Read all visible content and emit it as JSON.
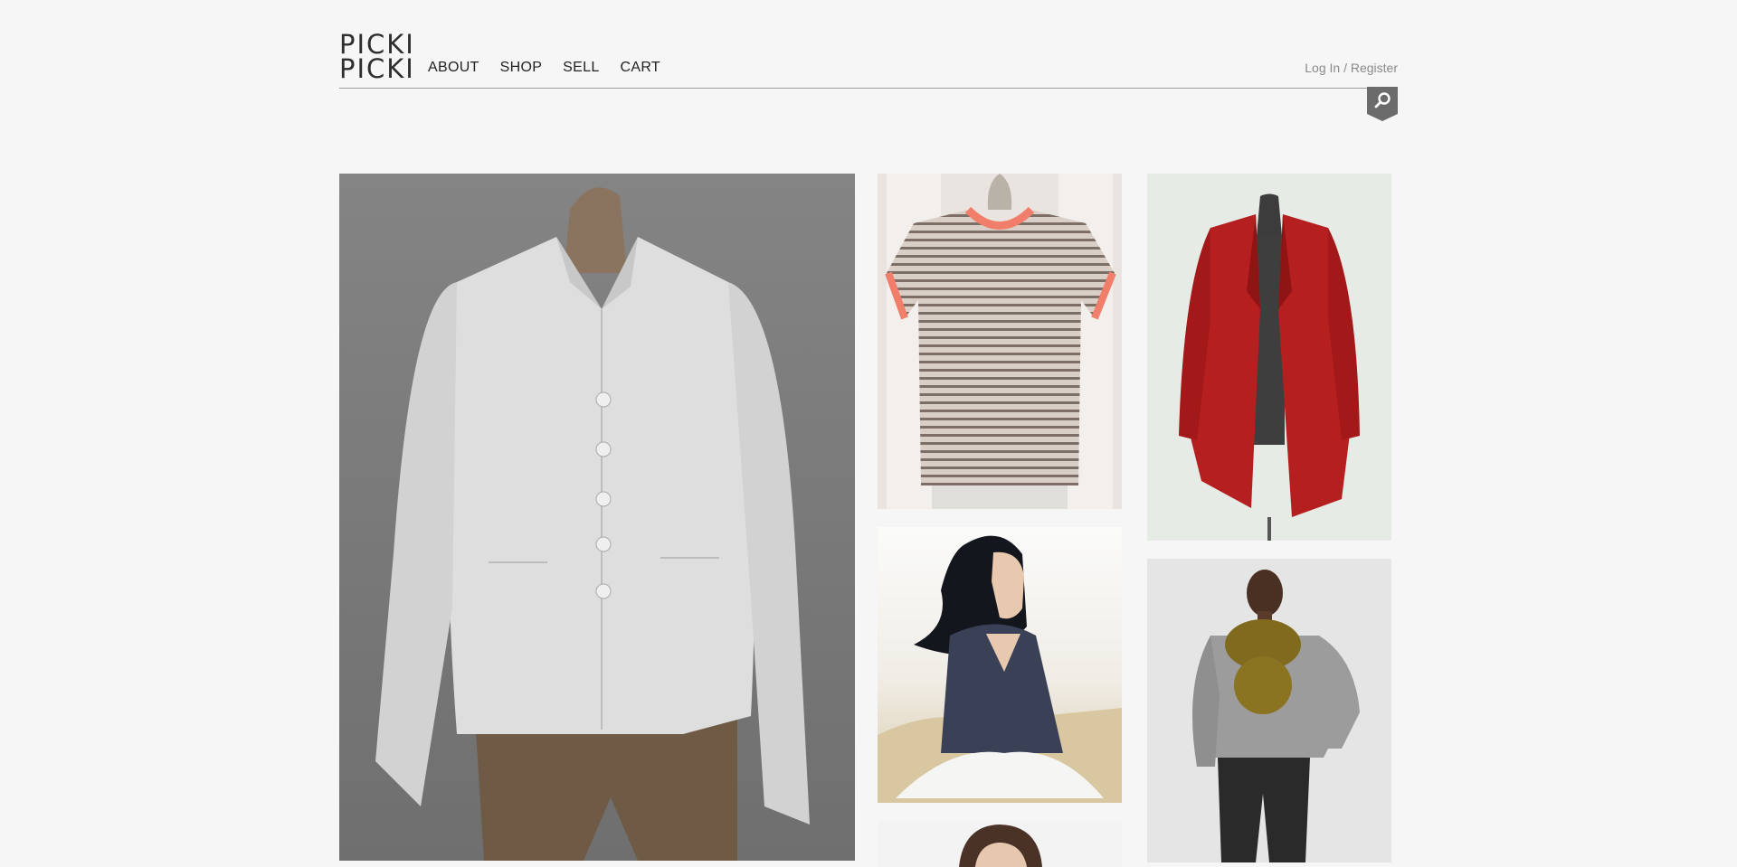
{
  "logo": {
    "line1": "PICKI",
    "line2": "PICKI"
  },
  "nav": {
    "about": "ABOUT",
    "shop": "SHOP",
    "sell": "SELL",
    "cart": "CART"
  },
  "account": {
    "login_label": "Log In / Register"
  },
  "search": {
    "icon": "search-icon"
  },
  "products": [
    {
      "name": "white-linen-jacket",
      "image": "white linen button jacket on mannequin"
    },
    {
      "name": "striped-tee",
      "image": "grey striped tee with coral trim"
    },
    {
      "name": "red-open-cardigan",
      "image": "red open-front cardigan on mannequin"
    },
    {
      "name": "navy-v-neck-sweater",
      "image": "woman in navy v-neck sweater sitting on sand"
    },
    {
      "name": "grey-sweater-with-scarf",
      "image": "woman in grey sweater with olive scarf"
    },
    {
      "name": "partial-portrait",
      "image": "partially visible portrait"
    }
  ],
  "colors": {
    "background": "#f6f6f6",
    "search_tab": "#6b6b6b"
  }
}
